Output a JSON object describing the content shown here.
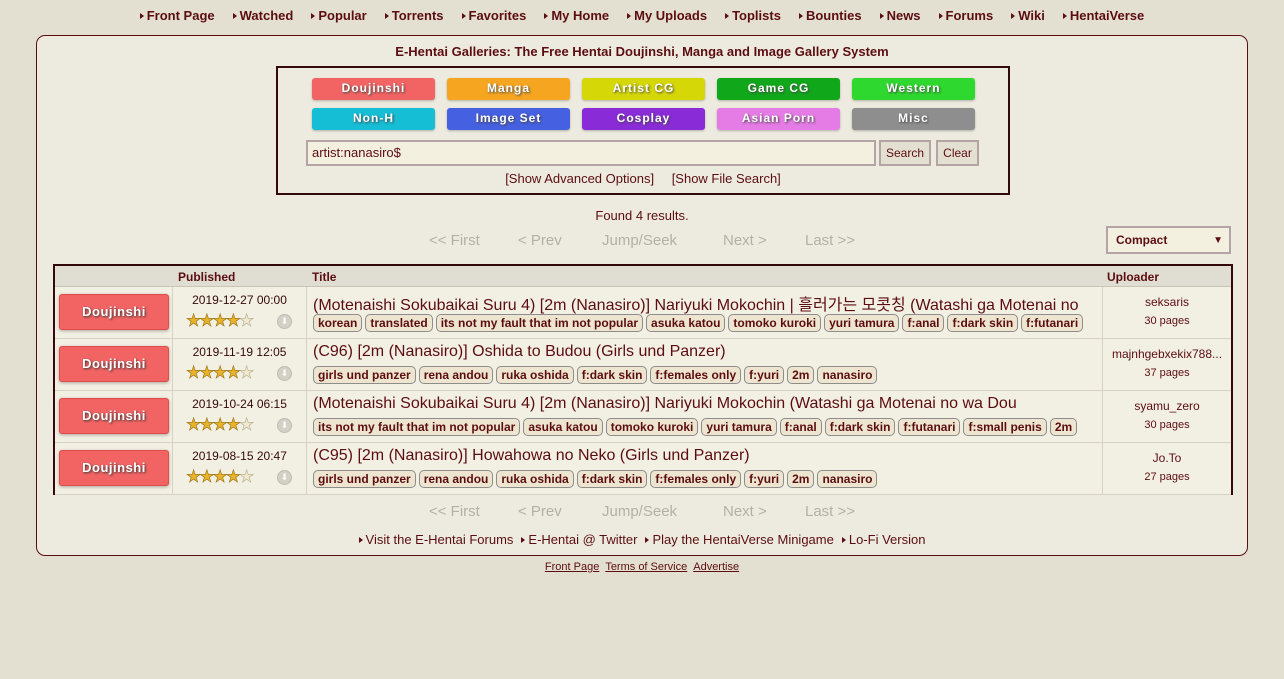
{
  "nav": [
    "Front Page",
    "Watched",
    "Popular",
    "Torrents",
    "Favorites",
    "My Home",
    "My Uploads",
    "Toplists",
    "Bounties",
    "News",
    "Forums",
    "Wiki",
    "HentaiVerse"
  ],
  "page_title": "E-Hentai Galleries: The Free Hentai Doujinshi, Manga and Image Gallery System",
  "categories": [
    {
      "label": "Doujinshi",
      "color": "#f26464"
    },
    {
      "label": "Manga",
      "color": "#f6a521"
    },
    {
      "label": "Artist CG",
      "color": "#d6d706"
    },
    {
      "label": "Game CG",
      "color": "#10a71b"
    },
    {
      "label": "Western",
      "color": "#2ed82e"
    },
    {
      "label": "Non-H",
      "color": "#15bdd5"
    },
    {
      "label": "Image Set",
      "color": "#4560e0"
    },
    {
      "label": "Cosplay",
      "color": "#8a2bd8"
    },
    {
      "label": "Asian Porn",
      "color": "#e57be5"
    },
    {
      "label": "Misc",
      "color": "#8e8e8e"
    }
  ],
  "search": {
    "value": "artist:nanasiro$",
    "search_label": "Search",
    "clear_label": "Clear"
  },
  "adv_links": {
    "advanced": "[Show Advanced Options]",
    "file": "[Show File Search]"
  },
  "found_text": "Found 4 results.",
  "pager": {
    "first": "<< First",
    "prev": "< Prev",
    "jump": "Jump/Seek",
    "next": "Next >",
    "last": "Last >>"
  },
  "display_mode": "Compact",
  "table": {
    "headers": {
      "published": "Published",
      "title": "Title",
      "uploader": "Uploader"
    },
    "rows": [
      {
        "category": "Doujinshi",
        "published": "2019-12-27 00:00",
        "rating": 4.5,
        "title": "(Motenaishi Sokubaikai Suru 4) [2m (Nanasiro)] Nariyuki Mokochin | 흘러가는 모콧칭 (Watashi ga Motenai no",
        "tags": [
          "korean",
          "translated",
          "its not my fault that im not popular",
          "asuka katou",
          "tomoko kuroki",
          "yuri tamura",
          "f:anal",
          "f:dark skin",
          "f:futanari"
        ],
        "uploader": "seksaris",
        "pages": "30 pages"
      },
      {
        "category": "Doujinshi",
        "published": "2019-11-19 12:05",
        "rating": 4.5,
        "title": "(C96) [2m (Nanasiro)] Oshida to Budou (Girls und Panzer)",
        "tags": [
          "girls und panzer",
          "rena andou",
          "ruka oshida",
          "f:dark skin",
          "f:females only",
          "f:yuri",
          "2m",
          "nanasiro"
        ],
        "uploader": "majnhgebxekix788...",
        "pages": "37 pages"
      },
      {
        "category": "Doujinshi",
        "published": "2019-10-24 06:15",
        "rating": 4.5,
        "title": "(Motenaishi Sokubaikai Suru 4) [2m (Nanasiro)] Nariyuki Mokochin (Watashi ga Motenai no wa Dou",
        "tags": [
          "its not my fault that im not popular",
          "asuka katou",
          "tomoko kuroki",
          "yuri tamura",
          "f:anal",
          "f:dark skin",
          "f:futanari",
          "f:small penis",
          "2m"
        ],
        "uploader": "syamu_zero",
        "pages": "30 pages"
      },
      {
        "category": "Doujinshi",
        "published": "2019-08-15 20:47",
        "rating": 4.5,
        "title": "(C95) [2m (Nanasiro)] Howahowa no Neko (Girls und Panzer)",
        "tags": [
          "girls und panzer",
          "rena andou",
          "ruka oshida",
          "f:dark skin",
          "f:females only",
          "f:yuri",
          "2m",
          "nanasiro"
        ],
        "uploader": "Jo.To",
        "pages": "27 pages"
      }
    ]
  },
  "footer_links": [
    "Visit the E-Hentai Forums",
    "E-Hentai @ Twitter",
    "Play the HentaiVerse Minigame",
    "Lo-Fi Version"
  ],
  "bottom_links": [
    "Front Page",
    "Terms of Service",
    "Advertise"
  ]
}
